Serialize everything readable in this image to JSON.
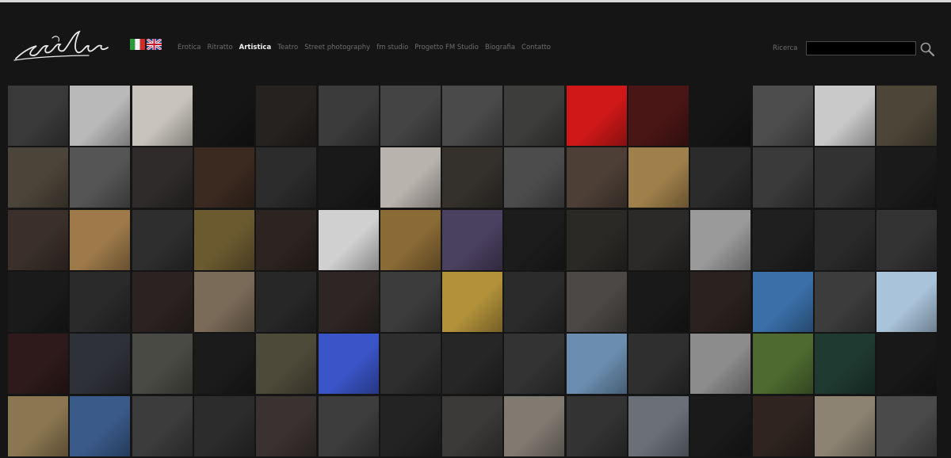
{
  "header": {
    "logo_name": "signature-logo",
    "languages": [
      {
        "name": "italian-flag-icon",
        "label": "Italiano"
      },
      {
        "name": "english-flag-icon",
        "label": "English"
      }
    ],
    "nav": [
      {
        "label": "Erotica",
        "active": false
      },
      {
        "label": "Ritratto",
        "active": false
      },
      {
        "label": "Artistica",
        "active": true
      },
      {
        "label": "Teatro",
        "active": false
      },
      {
        "label": "Street photography",
        "active": false
      },
      {
        "label": "fm studio",
        "active": false
      },
      {
        "label": "Progetto FM Studio",
        "active": false
      },
      {
        "label": "Biografia",
        "active": false
      },
      {
        "label": "Contatto",
        "active": false
      }
    ],
    "search": {
      "label": "Ricerca",
      "value": "",
      "icon": "magnifier-icon"
    }
  },
  "gallery": {
    "columns": 15,
    "rows": [
      [
        "#3a3a3a",
        "#b9b9b9",
        "#c8c4bc",
        "#151515",
        "#262220",
        "#3b3b3b",
        "#444444",
        "#4a4a4a",
        "#3d3d3b",
        "#d01818",
        "#4a1515",
        "#151515",
        "#4d4d4d",
        "#c9c9c9",
        "#4d4638"
      ],
      [
        "#4b4438",
        "#555555",
        "#2e2b2a",
        "#3b2a20",
        "#2c2c2c",
        "#191919",
        "#b9b3ad",
        "#34312d",
        "#4c4c4c",
        "#4d3f36",
        "#a0804a",
        "#2b2b2b",
        "#3a3a3a",
        "#323232",
        "#1a1a1a"
      ],
      [
        "#3a2f2a",
        "#9e7a4a",
        "#2e2e2e",
        "#6b5a30",
        "#2c2420",
        "#d0d0d0",
        "#8a6a35",
        "#4a4060",
        "#1c1c1c",
        "#2b2926",
        "#2c2a28",
        "#9a9a9a",
        "#1f1f1f",
        "#2a2a2a",
        "#333333"
      ],
      [
        "#1a1a1a",
        "#2a2a2a",
        "#2b2321",
        "#7a6a58",
        "#272727",
        "#2e2624",
        "#3c3c3c",
        "#b2913a",
        "#2b2b2b",
        "#4b4845",
        "#191919",
        "#2a221e",
        "#3a6fa8",
        "#3c3c3c",
        "#a9c3da"
      ],
      [
        "#2e1a1a",
        "#2f3138",
        "#4a4a44",
        "#1b1b1b",
        "#4e4a3a",
        "#3a55c8",
        "#2e2e2e",
        "#262626",
        "#333333",
        "#6b8eb0",
        "#2f2f2f",
        "#8c8c8c",
        "#4e6a30",
        "#1f3a30",
        "#181818"
      ],
      [
        "#8a7650",
        "#3a5a8a",
        "#3c3c3c",
        "#2c2c2c",
        "#3a3230",
        "#3d3d3d",
        "#232323",
        "#3c3a38",
        "#807a70",
        "#333333",
        "#6a6f78",
        "#1a1a1a",
        "#2f241f",
        "#8d8373",
        "#4a4a4a"
      ]
    ]
  }
}
